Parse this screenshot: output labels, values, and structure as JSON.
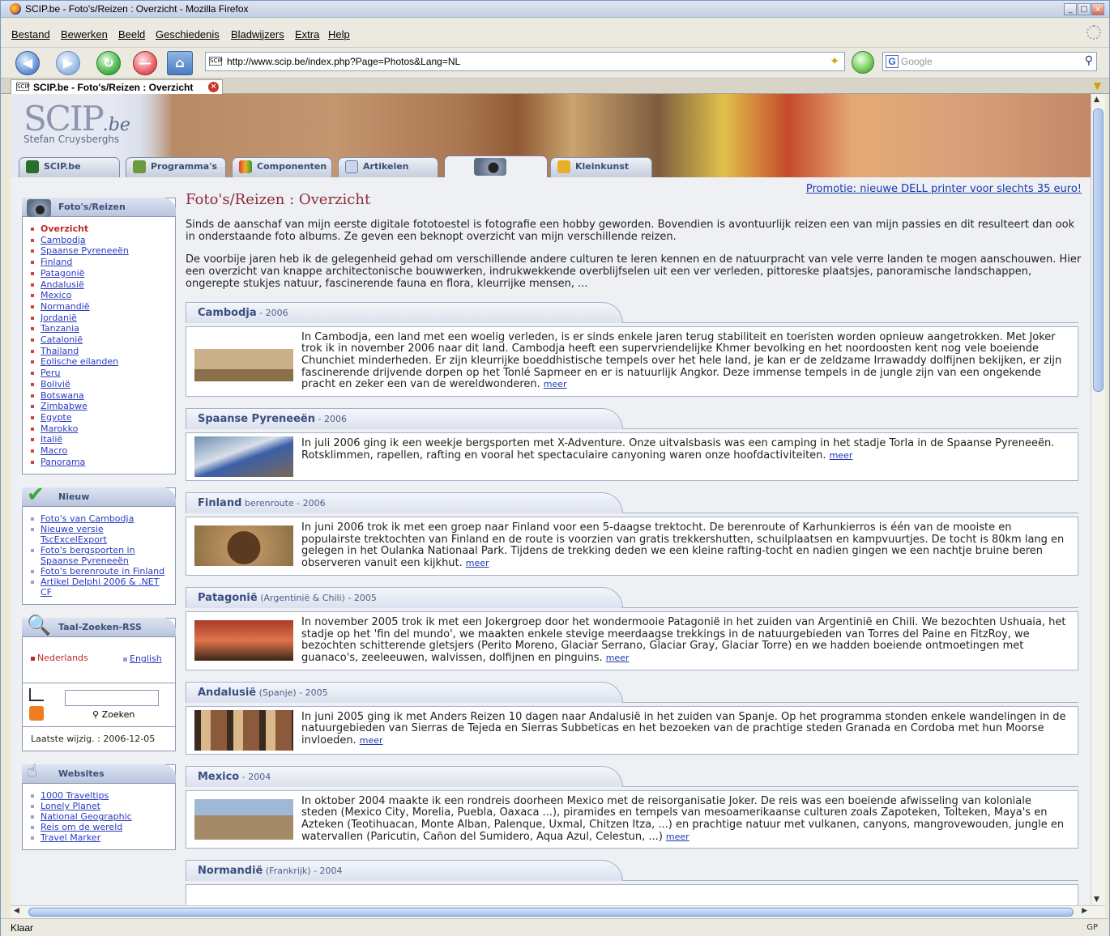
{
  "window": {
    "title": "SCIP.be - Foto's/Reizen : Overzicht - Mozilla Firefox",
    "controls": [
      "_",
      "□",
      "×"
    ]
  },
  "menu": [
    "Bestand",
    "Bewerken",
    "Beeld",
    "Geschiedenis",
    "Bladwijzers",
    "Extra",
    "Help"
  ],
  "toolbar": {
    "url": "http://www.scip.be/index.php?Page=Photos&Lang=NL",
    "search_placeholder": "Google",
    "site_icon": "SCIP"
  },
  "tab": {
    "label": "SCIP.be - Foto's/Reizen : Overzicht",
    "icon": "SCIP"
  },
  "status": {
    "text": "Klaar",
    "right": "GP"
  },
  "site": {
    "logo_main": "SCIP",
    "logo_suffix": ".be",
    "author": "Stefan Cruysberghs",
    "tabs": [
      "SCIP.be",
      "Programma's",
      "Componenten",
      "Artikelen",
      "",
      "Kleinkunst"
    ]
  },
  "sidebar": {
    "photos": {
      "title": "Foto's/Reizen",
      "items": [
        "Overzicht",
        "Cambodja",
        "Spaanse Pyreneeën",
        "Finland",
        "Patagonië",
        "Andalusië",
        "Mexico",
        "Normandië",
        "Jordanië",
        "Tanzania",
        "Catalonië",
        "Thailand",
        "Eolische eilanden",
        "Peru",
        "Bolivië",
        "Botswana",
        "Zimbabwe",
        "Egypte",
        "Marokko",
        "Italië",
        "Macro",
        "Panorama"
      ]
    },
    "news": {
      "title": "Nieuw",
      "items": [
        "Foto's van Cambodja",
        "Nieuwe versie TscExcelExport",
        "Foto's bergsporten in Spaanse Pyreneeën",
        "Foto's berenroute in Finland",
        "Artikel Delphi 2006 & .NET CF"
      ]
    },
    "lang": {
      "title": "Taal-Zoeken-RSS",
      "nl": "Nederlands",
      "en": "English",
      "search_button": "Zoeken",
      "last_modified": "Laatste wijzig. : 2006-12-05"
    },
    "websites": {
      "title": "Websites",
      "items": [
        "1000 Traveltips",
        "Lonely Planet",
        "National Geographic",
        "Reis om de wereld",
        "Travel Marker"
      ]
    }
  },
  "main": {
    "promo": "Promotie: nieuwe DELL printer voor slechts 35 euro!",
    "title": "Foto's/Reizen : Overzicht",
    "intro1": "Sinds de aanschaf van mijn eerste digitale fototoestel is fotografie een hobby geworden. Bovendien is avontuurlijk reizen een van mijn passies en dit resulteert dan ook in onderstaande foto albums. Ze geven een beknopt overzicht van mijn verschillende reizen.",
    "intro2": "De voorbije jaren heb ik de gelegenheid gehad om verschillende andere culturen te leren kennen en de natuurpracht van vele verre landen te mogen aanschouwen. Hier een overzicht van knappe architectonische bouwwerken, indrukwekkende overblijfselen uit een ver verleden, pittoreske plaatsjes, panoramische landschappen, ongerepte stukjes natuur, fascinerende fauna en flora, kleurrijke mensen, ...",
    "more": "meer",
    "sections": [
      {
        "title": "Cambodja",
        "sub": " - 2006",
        "text": "In Cambodja, een land met een woelig verleden, is er sinds enkele jaren terug stabiliteit en toeristen worden opnieuw aangetrokken. Met Joker trok ik in november 2006 naar dit land. Cambodja heeft een supervriendelijke Khmer bevolking en het noordoosten kent nog vele boeiende Chunchiet minderheden. Er zijn kleurrijke boeddhistische tempels over het hele land, je kan er de zeldzame Irrawaddy dolfijnen bekijken, er zijn fascinerende drijvende dorpen op het Tonlé Sapmeer en er is natuurlijk Angkor. Deze immense tempels in de jungle zijn van een ongekende pracht en zeker een van de wereldwonderen."
      },
      {
        "title": "Spaanse Pyreneeën",
        "sub": " - 2006",
        "text": "In juli 2006 ging ik een weekje bergsporten met X-Adventure. Onze uitvalsbasis was een camping in het stadje Torla in de Spaanse Pyreneeën. Rotsklimmen, rapellen, rafting en vooral het spectaculaire canyoning waren onze hoofdactiviteiten."
      },
      {
        "title": "Finland",
        "sub": " berenroute - 2006",
        "text": "In juni 2006 trok ik met een groep naar Finland voor een 5-daagse trektocht. De berenroute of Karhunkierros is één van de mooiste en populairste trektochten van Finland en de route is voorzien van gratis trekkershutten, schuilplaatsen en kampvuurtjes. De tocht is 80km lang en gelegen in het Oulanka Nationaal Park. Tijdens de trekking deden we een kleine rafting-tocht en nadien gingen we een nachtje bruine beren observeren vanuit een kijkhut."
      },
      {
        "title": "Patagonië",
        "sub": " (Argentinië & Chili) - 2005",
        "text": "In november 2005 trok ik met een Jokergroep door het wondermooie Patagonië in het zuiden van Argentinië en Chili. We bezochten Ushuaia, het stadje op het 'fin del mundo', we maakten enkele stevige meerdaagse trekkings in de natuurgebieden van Torres del Paine en FitzRoy, we bezochten schitterende gletsjers (Perito Moreno, Glaciar Serrano, Glaciar Gray, Glaciar Torre) en we hadden boeiende ontmoetingen met guanaco's, zeeleeuwen, walvissen, dolfijnen en pinguins."
      },
      {
        "title": "Andalusië",
        "sub": " (Spanje) - 2005",
        "text": "In juni 2005 ging ik met Anders Reizen 10 dagen naar Andalusië in het zuiden van Spanje. Op het programma stonden enkele wandelingen in de natuurgebieden van Sierras de Tejeda en Sierras Subbeticas en het bezoeken van de prachtige steden Granada en Cordoba met hun Moorse invloeden."
      },
      {
        "title": "Mexico",
        "sub": " - 2004",
        "text": "In oktober 2004 maakte ik een rondreis doorheen Mexico met de reisorganisatie Joker. De reis was een boeiende afwisseling van koloniale steden (Mexico City, Morelia, Puebla, Oaxaca ...), piramides en tempels van mesoamerikaanse culturen zoals Zapoteken, Tolteken, Maya's en Azteken (Teotihuacan, Monte Alban, Palenque, Uxmal, Chitzen Itza, ...) en prachtige natuur met vulkanen, canyons, mangrovewouden, jungle en watervallen (Paricutin, Cañon del Sumidero, Aqua Azul, Celestun, ...)"
      },
      {
        "title": "Normandië",
        "sub": " (Frankrijk) - 2004",
        "text": ""
      }
    ]
  }
}
